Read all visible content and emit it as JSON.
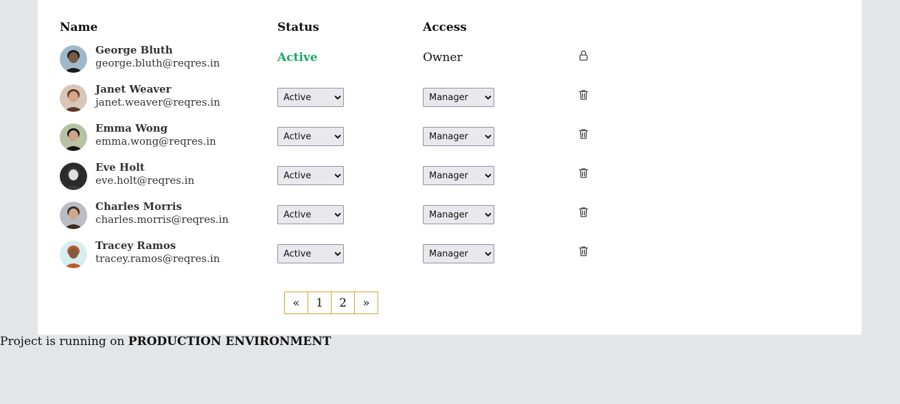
{
  "table": {
    "headers": {
      "name": "Name",
      "status": "Status",
      "access": "Access"
    },
    "rows": [
      {
        "name": "George Bluth",
        "email": "george.bluth@reqres.in",
        "status": "Active",
        "access": "Owner",
        "editable": false,
        "icon": "lock-icon",
        "avatar_bg": "#9fb8c9",
        "avatar_skin": "#7b5a45",
        "avatar_hair": "#1e1a17"
      },
      {
        "name": "Janet Weaver",
        "email": "janet.weaver@reqres.in",
        "status": "Active",
        "access": "Manager",
        "editable": true,
        "icon": "trash-icon",
        "avatar_bg": "#d8c6b8",
        "avatar_skin": "#d9a58a",
        "avatar_hair": "#5a3a27"
      },
      {
        "name": "Emma Wong",
        "email": "emma.wong@reqres.in",
        "status": "Active",
        "access": "Manager",
        "editable": true,
        "icon": "trash-icon",
        "avatar_bg": "#b6c2a3",
        "avatar_skin": "#caa58c",
        "avatar_hair": "#171312"
      },
      {
        "name": "Eve Holt",
        "email": "eve.holt@reqres.in",
        "status": "Active",
        "access": "Manager",
        "editable": true,
        "icon": "trash-icon",
        "avatar_bg": "#2b2b2b",
        "avatar_skin": "#e0e0e0",
        "avatar_hair": "#3a3a3a"
      },
      {
        "name": "Charles Morris",
        "email": "charles.morris@reqres.in",
        "status": "Active",
        "access": "Manager",
        "editable": true,
        "icon": "trash-icon",
        "avatar_bg": "#b9bcc4",
        "avatar_skin": "#d0a78e",
        "avatar_hair": "#3a2c22"
      },
      {
        "name": "Tracey Ramos",
        "email": "tracey.ramos@reqres.in",
        "status": "Active",
        "access": "Manager",
        "editable": true,
        "icon": "trash-icon",
        "avatar_bg": "#d5eef2",
        "avatar_skin": "#8a5a3e",
        "avatar_hair": "#c05a2c"
      }
    ]
  },
  "pagination": {
    "prev": "«",
    "pages": [
      "1",
      "2"
    ],
    "next": "»"
  },
  "footer": {
    "prefix": "Project is running on ",
    "environment": "PRODUCTION ENVIRONMENT"
  },
  "colors": {
    "active": "#1aa866",
    "pager_border": "#d4a52a",
    "background": "#e3e6e9"
  }
}
